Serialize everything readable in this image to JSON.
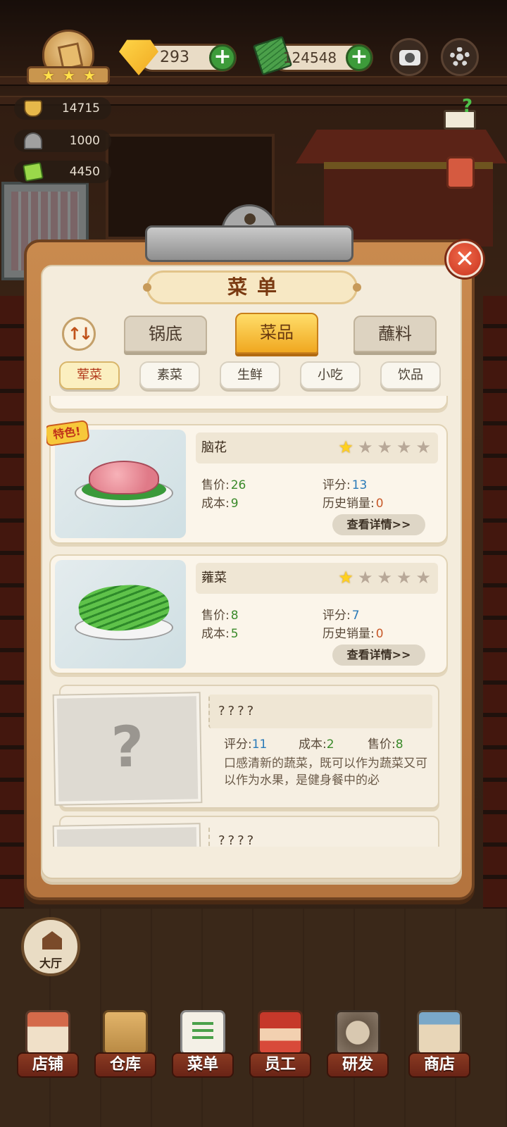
{
  "hud": {
    "gems": "293",
    "cash": "124548",
    "stats": [
      "14715",
      "1000",
      "4450"
    ]
  },
  "panel": {
    "title": "菜单",
    "tabs": [
      {
        "label": "锅底",
        "active": false
      },
      {
        "label": "菜品",
        "active": true
      },
      {
        "label": "蘸料",
        "active": false
      }
    ],
    "chips": [
      {
        "label": "荤菜",
        "active": true
      },
      {
        "label": "素菜",
        "active": false
      },
      {
        "label": "生鲜",
        "active": false
      },
      {
        "label": "小吃",
        "active": false
      },
      {
        "label": "饮品",
        "active": false
      }
    ]
  },
  "dishes": [
    {
      "name": "脑花",
      "badge": "特色!",
      "stars": 1,
      "price_label": "售价:",
      "price": "26",
      "cost_label": "成本:",
      "cost": "9",
      "score_label": "评分:",
      "score": "13",
      "sales_label": "历史销量:",
      "sales": "0",
      "detail_label": "查看详情>>",
      "icon": "brain-dish-icon"
    },
    {
      "name": "蕹菜",
      "stars": 1,
      "price_label": "售价:",
      "price": "8",
      "cost_label": "成本:",
      "cost": "5",
      "score_label": "评分:",
      "score": "7",
      "sales_label": "历史销量:",
      "sales": "0",
      "detail_label": "查看详情>>",
      "icon": "water-spinach-dish-icon"
    }
  ],
  "locked": [
    {
      "name": "????",
      "score_label": "评分:",
      "score": "11",
      "cost_label": "成本:",
      "cost": "2",
      "price_label": "售价:",
      "price": "8",
      "desc": "口感清新的蔬菜，既可以作为蔬菜又可以作为水果，是健身餐中的必"
    },
    {
      "name": "????"
    }
  ],
  "hall": {
    "label": "大厅"
  },
  "nav": [
    {
      "label": "店铺",
      "icon": "shop-icon"
    },
    {
      "label": "仓库",
      "icon": "warehouse-icon"
    },
    {
      "label": "菜单",
      "icon": "menu-icon"
    },
    {
      "label": "员工",
      "icon": "staff-icon"
    },
    {
      "label": "研发",
      "icon": "research-icon"
    },
    {
      "label": "商店",
      "icon": "store-icon"
    }
  ],
  "colors": {
    "accent": "#f0a820",
    "close": "#c9321e",
    "board": "#c98a4e",
    "paper": "#f4ecdc"
  }
}
